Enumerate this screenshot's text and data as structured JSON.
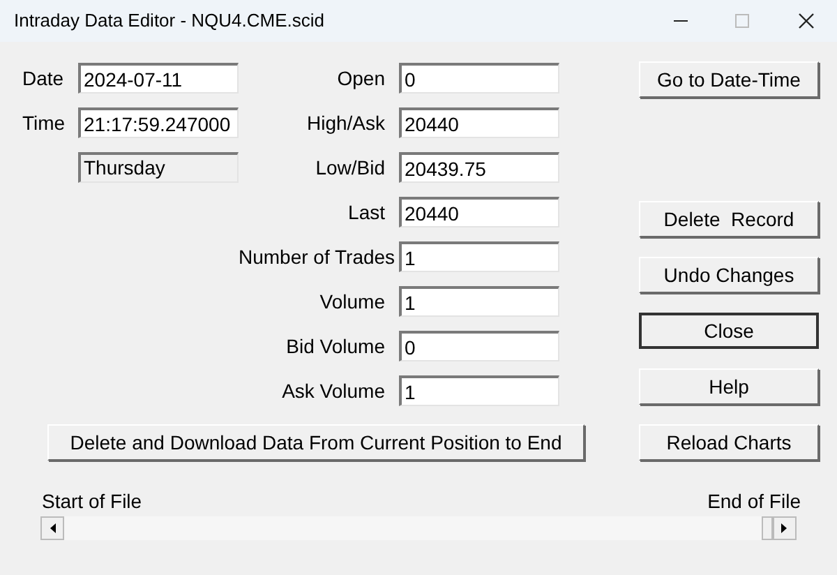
{
  "window": {
    "title": "Intraday Data Editor - NQU4.CME.scid"
  },
  "date": {
    "label": "Date",
    "value": "2024-07-11"
  },
  "time": {
    "label": "Time",
    "value": "21:17:59.247000"
  },
  "weekday": {
    "value": "Thursday"
  },
  "fields": [
    {
      "label": "Open",
      "value": "0"
    },
    {
      "label": "High/Ask",
      "value": "20440"
    },
    {
      "label": "Low/Bid",
      "value": "20439.75"
    },
    {
      "label": "Last",
      "value": "20440"
    },
    {
      "label": "Number of Trades",
      "value": "1"
    },
    {
      "label": "Volume",
      "value": "1"
    },
    {
      "label": "Bid Volume",
      "value": "0"
    },
    {
      "label": "Ask Volume",
      "value": "1"
    }
  ],
  "side_buttons": [
    {
      "label": "Go to Date-Time",
      "default": false
    },
    {
      "label": "Delete  Record",
      "default": false
    },
    {
      "label": "Undo Changes",
      "default": false
    },
    {
      "label": "Close",
      "default": true
    },
    {
      "label": "Help",
      "default": false
    },
    {
      "label": "Reload Charts",
      "default": false
    }
  ],
  "wide_button": {
    "label": "Delete and Download Data From Current Position to End"
  },
  "scroll": {
    "start_label": "Start of File",
    "end_label": "End of File"
  }
}
